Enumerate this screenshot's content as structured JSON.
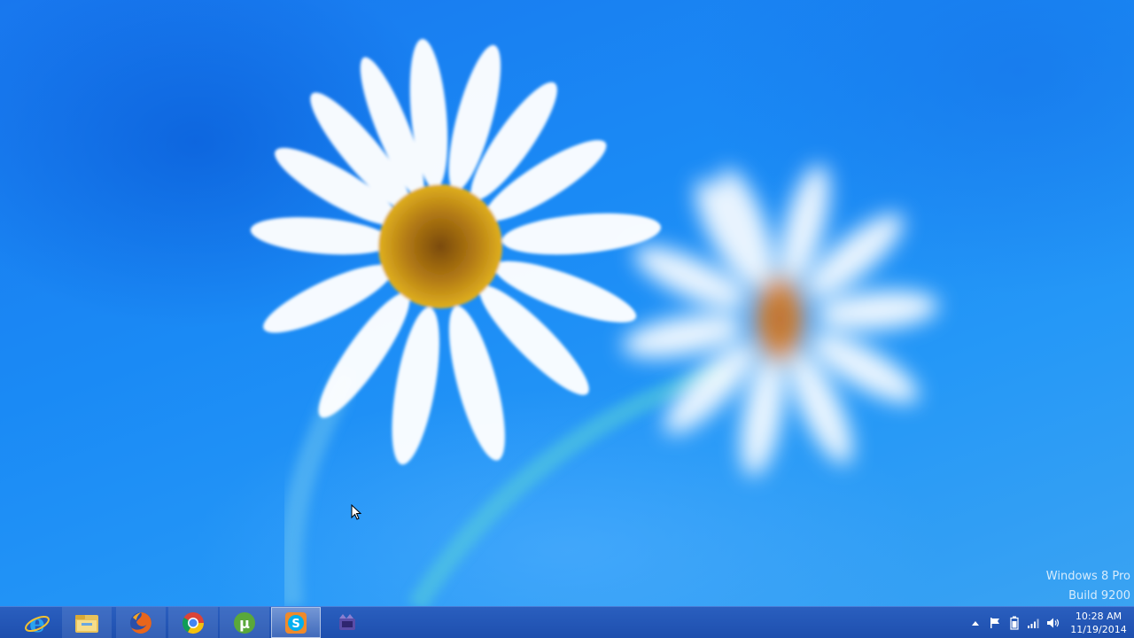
{
  "desktop": {
    "watermark_line1": "Windows 8 Pro",
    "watermark_line2": "Build 9200"
  },
  "taskbar": {
    "pinned": [
      {
        "name": "Internet Explorer",
        "icon": "internet-explorer-icon"
      },
      {
        "name": "File Explorer",
        "icon": "file-explorer-icon"
      },
      {
        "name": "Firefox",
        "icon": "firefox-icon"
      },
      {
        "name": "Google Chrome",
        "icon": "chrome-icon"
      },
      {
        "name": "uTorrent",
        "icon": "utorrent-icon"
      },
      {
        "name": "Skype",
        "icon": "skype-icon",
        "active": true
      },
      {
        "name": "Movie Maker",
        "icon": "movie-maker-icon"
      }
    ],
    "tray": {
      "icons": [
        "show-hidden-icons-icon",
        "action-center-flag-icon",
        "battery-icon",
        "network-signal-icon",
        "volume-icon"
      ],
      "time": "10:28 AM",
      "date": "11/19/2014"
    }
  },
  "colors": {
    "taskbar": "#1e4fae",
    "desktop_blue": "#1a8af5"
  }
}
